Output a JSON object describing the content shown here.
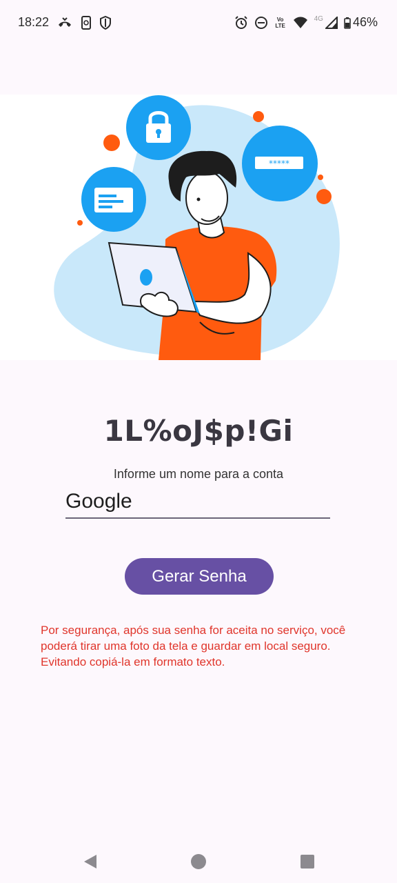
{
  "status_bar": {
    "time": "18:22",
    "battery": "46%",
    "network": "4G",
    "volte": "Vo LTE",
    "left_icons": [
      "missed-call-icon",
      "phone-sync-icon",
      "shield-icon"
    ],
    "right_icons": [
      "alarm-icon",
      "do-not-disturb-icon",
      "volte-icon",
      "wifi-icon",
      "signal-icon",
      "battery-icon"
    ]
  },
  "illustration": {
    "icons": [
      "lock-icon",
      "credit-card-icon",
      "password-field-icon",
      "laptop-icon"
    ],
    "colors": {
      "blob": "#c9e8fa",
      "circle": "#1ba1f2",
      "shirt": "#ff5b0f",
      "dot": "#ff5b0f"
    }
  },
  "main": {
    "generated_password": "1L%oJ$p!Gi",
    "prompt_label": "Informe um nome para a conta",
    "account_input": {
      "value": "Google"
    },
    "generate_button_label": "Gerar Senha",
    "warning_text": "Por segurança, após sua senha for aceita no serviço, você poderá tirar uma foto da tela e guardar em local seguro. Evitando copiá-la em formato texto."
  },
  "colors": {
    "accent": "#6750a4",
    "warning": "#e0352b",
    "background": "#fdf8fd"
  },
  "nav_bar": {
    "icons": [
      "back-icon",
      "home-icon",
      "recents-icon"
    ]
  }
}
